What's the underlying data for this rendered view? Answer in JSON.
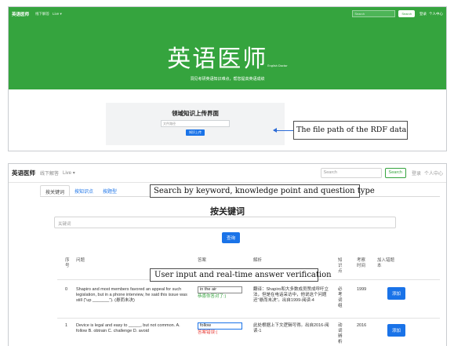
{
  "top": {
    "nav": {
      "brand": "英语医师",
      "link1": "线下解答",
      "link2": "Live ▾",
      "search_placeholder": "Search",
      "search_btn": "Search",
      "login": "登录",
      "profile": "个人中心"
    },
    "hero": {
      "title": "英语医师",
      "title_small": "English Doctor",
      "subtitle": "洞见考研英语知识难点，帮您提高英语成绩"
    },
    "upload": {
      "heading": "领域知识上传界面",
      "placeholder": "文件路径",
      "button": "知识上传"
    },
    "callout": "The file path of the RDF data"
  },
  "bottom": {
    "nav": {
      "brand": "英语医师",
      "link1": "线下解答",
      "link2": "Live ▾",
      "search_placeholder": "Search",
      "search_btn": "Search",
      "login": "登录",
      "profile": "个人中心"
    },
    "tabs": [
      "按关键词",
      "按知识点",
      "按题型"
    ],
    "callout_search": "Search by keyword, knowledge point and question type",
    "section_title": "按关键词",
    "keyword_placeholder": "关键词",
    "query_btn": "查询",
    "headers": {
      "seq": "序号",
      "question": "问题",
      "answer": "答案",
      "analysis": "解析",
      "knowledge": "知识点",
      "year": "考察时间",
      "add": "加入错题本"
    },
    "callout_verify": "User input and real-time answer verification",
    "rows": [
      {
        "seq": "0",
        "question": "Shapiro and most members favored an appeal for such legislation, but in a phone interview, he said this issue was still (\"up _______\"). (悬而未决)",
        "answer_value": "in the air",
        "feedback": "恭喜你答对了:)",
        "analysis": "翻译：Shapiro和大多数成员赞成呼吁立法，但是在电话采访中，他说这个问题还\"悬而未决\"。出自1999-阅读-4",
        "knowledge": "必考词组",
        "year": "1999",
        "add": "添加"
      },
      {
        "seq": "1",
        "question": "Device is legal and easy to _____, but not common. A. follow B. obtrain C. challenge D. avoid",
        "answer_value": "follow",
        "feedback": "答案错误:(",
        "analysis": "此处根据上下文逻辑可得。出自2016-阅读-1",
        "knowledge": "动词辨析",
        "year": "2016",
        "add": "添加"
      }
    ]
  },
  "colors": {
    "green": "#35a43e",
    "blue": "#1a73e8",
    "error": "#e53935"
  }
}
